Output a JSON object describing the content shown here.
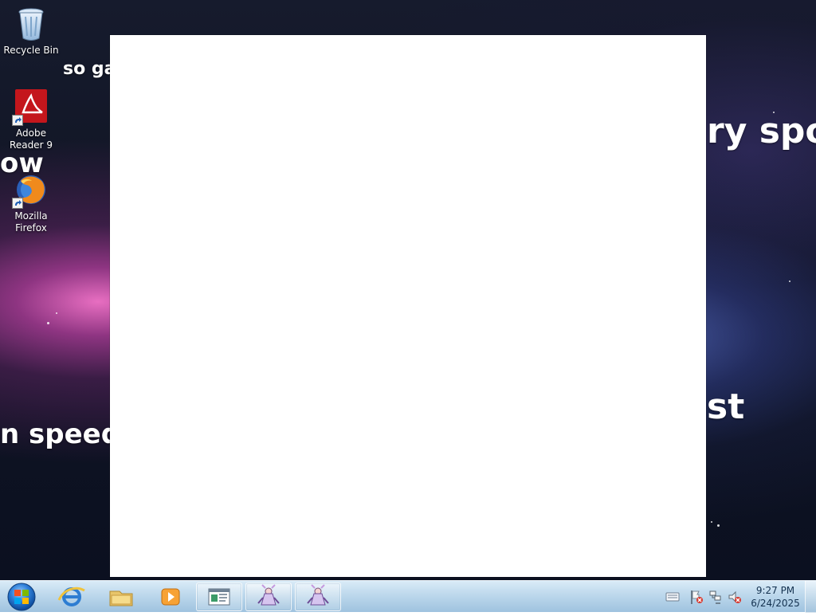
{
  "desktop": {
    "wallpaper": {
      "text_fragments": [
        "so gal",
        "ow",
        "n speed",
        "ry spo",
        "st"
      ]
    },
    "icons": [
      {
        "label": "Recycle Bin",
        "icon": "recycle-bin-icon"
      },
      {
        "label": "Adobe Reader 9",
        "icon": "adobe-reader-icon"
      },
      {
        "label": "Mozilla Firefox",
        "icon": "firefox-icon"
      }
    ]
  },
  "window": {
    "state": "blank"
  },
  "taskbar": {
    "start_button": {
      "icon": "windows-start-icon"
    },
    "pinned": [
      {
        "icon": "internet-explorer-icon"
      },
      {
        "icon": "file-explorer-icon"
      },
      {
        "icon": "media-player-icon"
      }
    ],
    "open_windows": [
      {
        "icon": "document-window-icon"
      },
      {
        "icon": "character-app-icon"
      },
      {
        "icon": "character-app-icon"
      }
    ],
    "tray": {
      "icons": [
        "keyboard-icon",
        "action-center-flag-icon",
        "network-icon",
        "volume-muted-icon"
      ],
      "time": "9:27 PM",
      "date": "6/24/2025"
    }
  },
  "colors": {
    "taskbar_top": "#d9ebf7",
    "taskbar_bottom": "#9fc3df",
    "window_background": "#ffffff",
    "desktop_text": "#ffffff"
  }
}
